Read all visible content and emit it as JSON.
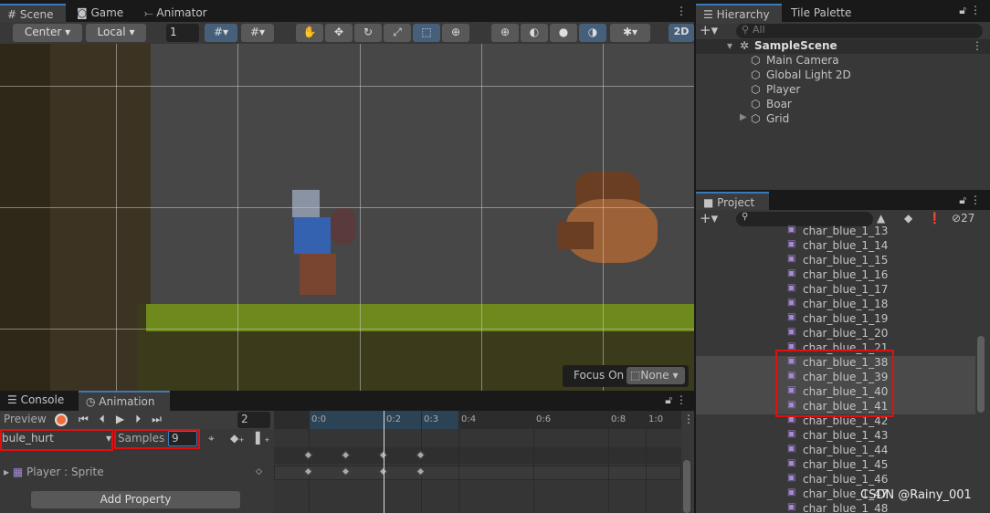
{
  "scene_tabs": [
    "Scene",
    "Game",
    "Animator"
  ],
  "toolbar": {
    "pivot": "Center",
    "space": "Local",
    "grid_size": "1",
    "mode_2d": "2D"
  },
  "toolbar_icons": [
    "grid-snap-icon",
    "snap-increment-icon",
    "hand-tool-icon",
    "move-tool-icon",
    "rotate-tool-icon",
    "scale-tool-icon",
    "rect-tool-icon",
    "transform-tool-icon",
    "wireframe-icon",
    "shaded-icon",
    "lit-icon",
    "lighting-icon",
    "gizmos-icon"
  ],
  "focus_on": {
    "label": "Focus On",
    "value": "None"
  },
  "bottom_tabs": [
    "Console",
    "Animation"
  ],
  "animation": {
    "preview": "Preview",
    "frame": "2",
    "clip": "bule_hurt",
    "samples_label": "Samples",
    "samples": "9",
    "property": "Player : Sprite",
    "add_property": "Add Property",
    "ticks": [
      "0:0",
      "0:2",
      "0:3",
      "0:4",
      "0:6",
      "0:8",
      "1:0"
    ],
    "keyframes": [
      0,
      1,
      2,
      3
    ],
    "current_frame": 2
  },
  "hierarchy": {
    "tabs": [
      "Hierarchy",
      "Tile Palette"
    ],
    "search_placeholder": "All",
    "scene": "SampleScene",
    "items": [
      "Main Camera",
      "Global Light 2D",
      "Player",
      "Boar",
      "Grid"
    ]
  },
  "project": {
    "tab": "Project",
    "hidden_count": "27",
    "items": [
      "char_blue_1_13",
      "char_blue_1_14",
      "char_blue_1_15",
      "char_blue_1_16",
      "char_blue_1_17",
      "char_blue_1_18",
      "char_blue_1_19",
      "char_blue_1_20",
      "char_blue_1_21",
      "char_blue_1_38",
      "char_blue_1_39",
      "char_blue_1_40",
      "char_blue_1_41",
      "char_blue_1_42",
      "char_blue_1_43",
      "char_blue_1_44",
      "char_blue_1_45",
      "char_blue_1_46",
      "char_blue_1_47",
      "char_blue_1_48"
    ],
    "selected": [
      "char_blue_1_38",
      "char_blue_1_39",
      "char_blue_1_40",
      "char_blue_1_41"
    ]
  },
  "watermark": "CSDN @Rainy_001"
}
